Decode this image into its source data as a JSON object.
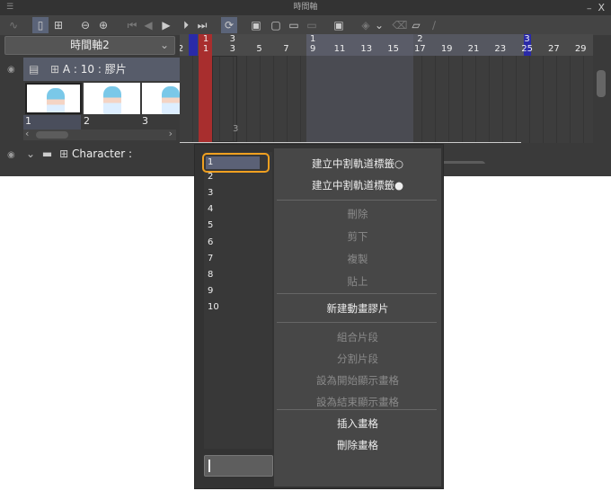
{
  "window": {
    "title": "時間軸",
    "menu_icon": "hamburger-icon",
    "minimize": "_",
    "close": "X"
  },
  "toolbar": {
    "icons": [
      "graph-icon",
      "thumbnail-view-icon",
      "add-layer-icon",
      "zoom-out-icon",
      "zoom-in-icon",
      "first-frame-icon",
      "prev-frame-icon",
      "play-icon",
      "next-frame-icon",
      "last-frame-icon",
      "loop-icon",
      "new-animation-folder-icon",
      "new-cel-icon",
      "link-cel-icon",
      "unlink-cel-icon",
      "onion-skin-icon",
      "transform-icon",
      "dropdown-icon",
      "delete-keyframe-icon",
      "light-table-icon",
      "pen-icon"
    ]
  },
  "timeline_select": {
    "value": "時間軸2"
  },
  "ruler": {
    "top": [
      "1",
      "3",
      "1",
      "2",
      "3"
    ],
    "frames": [
      "2",
      "1",
      "3",
      "5",
      "7",
      "9",
      "11",
      "13",
      "15",
      "17",
      "19",
      "21",
      "23",
      "25",
      "27",
      "29"
    ]
  },
  "colors": {
    "current_frame": "#a82e2e",
    "marker": "#2a2aa8",
    "selection_range": "#5a5c68",
    "focus": "#f0a020"
  },
  "layers": [
    {
      "name": "A : 10 : 膠片",
      "visible": true,
      "thumbnails": [
        "1",
        "2",
        "3"
      ],
      "cel_label": "3"
    },
    {
      "name": "Character :",
      "visible": true,
      "expanded": true
    }
  ],
  "popup": {
    "cels": [
      "1",
      "2",
      "3",
      "4",
      "5",
      "6",
      "7",
      "8",
      "9",
      "10"
    ],
    "selected": "1",
    "input_value": "",
    "menu": [
      {
        "label": "建立中割軌道標籤○",
        "enabled": true
      },
      {
        "label": "建立中割軌道標籤●",
        "enabled": true
      },
      {
        "label": "刪除",
        "enabled": false
      },
      {
        "label": "剪下",
        "enabled": false
      },
      {
        "label": "複製",
        "enabled": false
      },
      {
        "label": "貼上",
        "enabled": false
      },
      {
        "label": "新建動畫膠片",
        "enabled": true
      },
      {
        "label": "組合片段",
        "enabled": false
      },
      {
        "label": "分割片段",
        "enabled": false
      },
      {
        "label": "設為開始顯示畫格",
        "enabled": false
      },
      {
        "label": "設為結束顯示畫格",
        "enabled": false
      },
      {
        "label": "插入畫格",
        "enabled": true
      },
      {
        "label": "刪除畫格",
        "enabled": true
      }
    ]
  }
}
